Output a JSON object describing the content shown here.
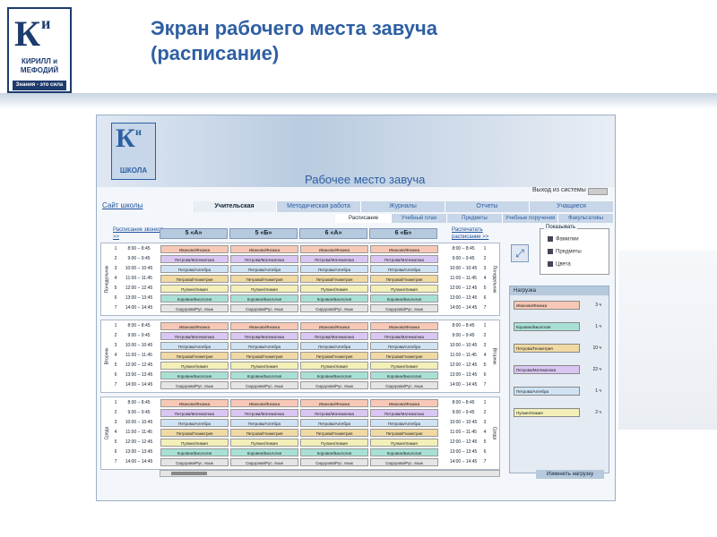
{
  "slide": {
    "title_line1": "Экран рабочего места завуча",
    "title_line2": "(расписание)",
    "logo_k": "К",
    "logo_i": "и",
    "logo_m": "М",
    "logo_name": "КИРИЛЛ и МЕФОДИЙ",
    "logo_tag": "Знания - это сила"
  },
  "app": {
    "logo_k": "К",
    "logo_i": "и",
    "logo_m": "М",
    "logo_school": "ШКОЛА",
    "title": "Рабочее место завуча",
    "site_link": "Сайт школы",
    "exit": "Выход из системы",
    "tabs": [
      "Учительская",
      "Методическая работа",
      "Журналы",
      "Отчеты",
      "Учащиеся"
    ],
    "subtabs": [
      "Расписание",
      "Учебный план",
      "Предметы",
      "Учебные поручения",
      "Факультативы"
    ],
    "bells_link": "Расписание звонков >>",
    "bells_link_right": "Распечатать расписание >>",
    "classes": [
      "5 «А»",
      "5 «Б»",
      "6 «А»",
      "6 «Б»"
    ],
    "days": [
      "Понедельник",
      "Вторник",
      "Среда"
    ],
    "times": [
      "8:00 – 8:45",
      "9:00 – 9:45",
      "10:00 – 10:45",
      "11:00 – 11:45",
      "12:00 – 12:45",
      "13:00 – 13:45",
      "14:00 – 14:45"
    ],
    "lessons": [
      "Иванова/Физика",
      "Петрова/Математика",
      "Петрова/Алгебра",
      "Петрова/Геометрия",
      "Пупкин/Химия",
      "Коровин/Биология",
      "Сидорова/Рус. язык"
    ],
    "lesson_colors": [
      "peach",
      "lilac",
      "blue",
      "tan",
      "yellow",
      "teal",
      "gray"
    ],
    "show_title": "Показывать",
    "show_items": [
      "Фамилии",
      "Предметы",
      "Цвета"
    ],
    "load_title": "Нагрузка",
    "load_items": [
      {
        "name": "Иванова/Физика",
        "hours": "3 ч",
        "color": "peach"
      },
      {
        "name": "Коровин/Биология",
        "hours": "1 ч",
        "color": "teal"
      },
      {
        "name": "Петрова/Геометрия",
        "hours": "10 ч",
        "color": "tan"
      },
      {
        "name": "Петрова/Математика",
        "hours": "22 ч",
        "color": "lilac"
      },
      {
        "name": "Петрова/Алгебра",
        "hours": "1 ч",
        "color": "blue"
      },
      {
        "name": "Пупкин/Химия",
        "hours": "2 ч",
        "color": "yellow"
      }
    ],
    "change_load": "Изменить нагрузку"
  }
}
